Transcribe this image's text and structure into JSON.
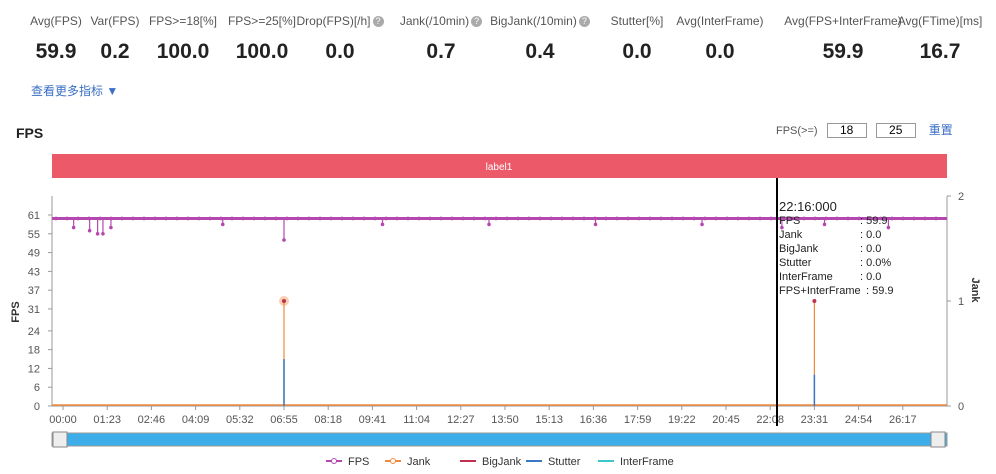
{
  "metrics": [
    {
      "label": "Avg(FPS)",
      "value": "59.9"
    },
    {
      "label": "Var(FPS)",
      "value": "0.2"
    },
    {
      "label": "FPS>=18[%]",
      "value": "100.0"
    },
    {
      "label": "FPS>=25[%]",
      "value": "100.0"
    },
    {
      "label": "Drop(FPS)[/h]",
      "value": "0.0",
      "help": true
    },
    {
      "label": "Jank(/10min)",
      "value": "0.7",
      "help": true
    },
    {
      "label": "BigJank(/10min)",
      "value": "0.4",
      "help": true
    },
    {
      "label": "Stutter[%]",
      "value": "0.0"
    },
    {
      "label": "Avg(InterFrame)",
      "value": "0.0"
    },
    {
      "label": "Avg(FPS+InterFrame)",
      "value": "59.9"
    },
    {
      "label": "Avg(FTime)[ms]",
      "value": "16.7"
    }
  ],
  "more_link": "查看更多指标 ▼",
  "chart_title": "FPS",
  "fps_filter": {
    "label": "FPS(>=)",
    "low": "18",
    "high": "25",
    "reset": "重置"
  },
  "label_band": "label1",
  "colors": {
    "band": "#ec5a6a",
    "fps": "#b548b0",
    "jank": "#ef8a3c",
    "bigjank": "#c0304f",
    "stutter": "#3a78c4",
    "interframe": "#3cc8c8",
    "slider": "#3daee9"
  },
  "chart_data": {
    "type": "line",
    "ylabel": "FPS",
    "y2label": "Jank",
    "yticks": [
      0,
      6,
      12,
      18,
      24,
      31,
      37,
      43,
      49,
      55,
      61
    ],
    "y2ticks": [
      0,
      1,
      2
    ],
    "xticks": [
      "00:00",
      "01:23",
      "02:46",
      "04:09",
      "05:32",
      "06:55",
      "08:18",
      "09:41",
      "11:04",
      "12:27",
      "13:50",
      "15:13",
      "16:36",
      "17:59",
      "19:22",
      "20:45",
      "22:08",
      "23:31",
      "24:54",
      "26:17"
    ],
    "fps_baseline": 59.9,
    "fps_dips": [
      [
        20,
        57
      ],
      [
        50,
        56
      ],
      [
        65,
        55
      ],
      [
        75,
        55
      ],
      [
        90,
        57
      ],
      [
        300,
        58
      ],
      [
        415,
        53
      ],
      [
        600,
        58
      ],
      [
        800,
        58
      ],
      [
        1000,
        58
      ],
      [
        1200,
        58
      ],
      [
        1350,
        57
      ],
      [
        1430,
        58
      ],
      [
        1550,
        57
      ]
    ],
    "jank": [
      [
        415,
        1
      ],
      [
        1411,
        1
      ]
    ],
    "stutter": [
      [
        415,
        15
      ],
      [
        1411,
        10
      ]
    ],
    "legend": [
      "FPS",
      "Jank",
      "BigJank",
      "Stutter",
      "InterFrame"
    ]
  },
  "tooltip": {
    "time": "22:16:000",
    "rows": [
      [
        "FPS",
        ": 59.9"
      ],
      [
        "Jank",
        ": 0.0"
      ],
      [
        "BigJank",
        ": 0.0"
      ],
      [
        "Stutter",
        ": 0.0%"
      ],
      [
        "InterFrame",
        ": 0.0"
      ],
      [
        "FPS+InterFrame",
        ": 59.9"
      ]
    ]
  }
}
